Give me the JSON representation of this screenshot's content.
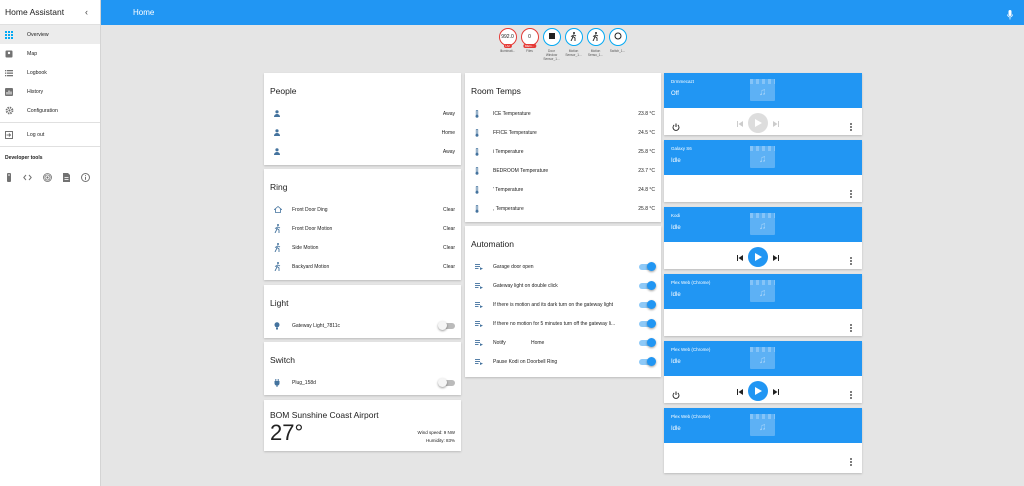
{
  "app": {
    "title": "Home Assistant",
    "page_title": "Home"
  },
  "sidebar": {
    "items": [
      {
        "label": "Overview",
        "active": true,
        "icon": "grid-icon"
      },
      {
        "label": "Map",
        "icon": "map-icon"
      },
      {
        "label": "Logbook",
        "icon": "logbook-icon"
      },
      {
        "label": "History",
        "icon": "history-icon"
      },
      {
        "label": "Configuration",
        "icon": "gear-icon"
      }
    ],
    "logout": "Log out",
    "dev_tools_title": "Developer tools",
    "dev_tools_icons": [
      "remote-icon",
      "code-icon",
      "radio-tower-icon",
      "file-icon",
      "info-icon"
    ]
  },
  "badges": [
    {
      "value": "992.0",
      "unit": "LM",
      "label": "Illuminati...",
      "color": "#e53935"
    },
    {
      "value": "0",
      "unit": "MEG...",
      "label": "Files",
      "color": "#e53935"
    },
    {
      "icon": "stop-icon",
      "label": "Door\nWindow\nSensor_1...",
      "color": "#03a9f4"
    },
    {
      "icon": "walk-icon",
      "label": "Motion\nSensor_1...",
      "color": "#03a9f4"
    },
    {
      "icon": "walk-icon",
      "label": "Motion\nSenso_1...",
      "color": "#03a9f4"
    },
    {
      "icon": "circle-icon",
      "label": "Switch_1...",
      "color": "#03a9f4"
    }
  ],
  "people": {
    "title": "People",
    "rows": [
      {
        "state": "Away"
      },
      {
        "state": "Home"
      },
      {
        "state": "Away"
      }
    ]
  },
  "ring": {
    "title": "Ring",
    "rows": [
      {
        "name": "Front Door Ding",
        "state": "Clear",
        "icon": "home-icon"
      },
      {
        "name": "Front Door Motion",
        "state": "Clear",
        "icon": "walk-icon"
      },
      {
        "name": "Side Motion",
        "state": "Clear",
        "icon": "walk-icon"
      },
      {
        "name": "Backyard Motion",
        "state": "Clear",
        "icon": "walk-icon"
      }
    ]
  },
  "light": {
    "title": "Light",
    "rows": [
      {
        "name": "Gateway Light_7811c",
        "on": false
      }
    ]
  },
  "switch": {
    "title": "Switch",
    "rows": [
      {
        "name": "Plug_158d",
        "on": false
      }
    ]
  },
  "weather": {
    "title": "BOM Sunshine Coast Airport",
    "temp": "27°",
    "wind": "Wind speed: 9 NW",
    "humidity": "Humidity: 83%"
  },
  "room_temps": {
    "title": "Room Temps",
    "rows": [
      {
        "name": "ICE Temperature",
        "value": "23.8 °C"
      },
      {
        "name": "FFICE Temperature",
        "value": "24.5 °C"
      },
      {
        "name": "i Temperature",
        "value": "25.8 °C"
      },
      {
        "name": "BEDROOM Temperature",
        "value": "23.7 °C"
      },
      {
        "name": "' Temperature",
        "value": "24.8 °C"
      },
      {
        "name": ", Temperature",
        "value": "25.8 °C"
      }
    ]
  },
  "automation": {
    "title": "Automation",
    "rows": [
      {
        "name": "Garage door open",
        "on": true
      },
      {
        "name": "Gateway light on double click",
        "on": true
      },
      {
        "name": "If there is motion and its dark turn on the gateway light",
        "on": true
      },
      {
        "name": "If there no motion for 5 minutes turn off the gateway li...",
        "on": true
      },
      {
        "name": "Notify",
        "extra": "Home",
        "on": true
      },
      {
        "name": "Pause Kodi on Doorbell Ring",
        "on": true
      }
    ]
  },
  "media": [
    {
      "name": "Drmmecazt",
      "state": "Off",
      "controls": "full-disabled"
    },
    {
      "name": "Galaxy S6",
      "state": "Idle",
      "controls": "more"
    },
    {
      "name": "Kodi",
      "state": "Idle",
      "controls": "play"
    },
    {
      "name": "Plex Web (Chrome)",
      "state": "Idle",
      "controls": "more"
    },
    {
      "name": "Plex Web (Chrome)",
      "state": "Idle",
      "controls": "full"
    },
    {
      "name": "Plex Web (Chrome)",
      "state": "Idle",
      "controls": "more"
    }
  ]
}
